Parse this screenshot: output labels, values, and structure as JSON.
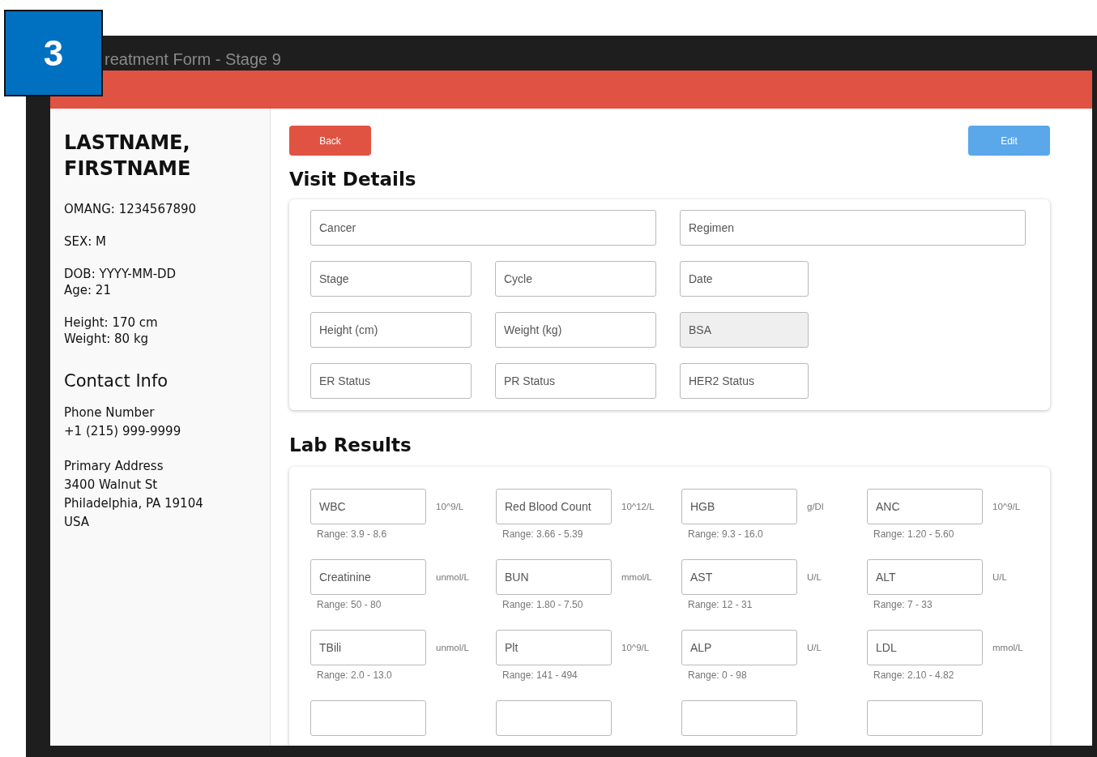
{
  "step_badge": "3",
  "window": {
    "title": "reatment Form - Stage 9"
  },
  "patient": {
    "name": "LASTNAME, FIRSTNAME",
    "details": [
      [
        "OMANG: 1234567890"
      ],
      [
        "SEX: M"
      ],
      [
        "DOB: YYYY-MM-DD",
        "Age: 21"
      ],
      [
        "Height: 170 cm",
        "Weight: 80 kg"
      ]
    ]
  },
  "contact": {
    "title": "Contact Info",
    "groups": [
      {
        "label": "Phone Number",
        "lines": [
          "+1 (215) 999-9999"
        ]
      },
      {
        "label": "Primary Address",
        "lines": [
          "3400 Walnut St",
          "Philadelphia, PA 19104",
          "USA"
        ]
      }
    ]
  },
  "buttons": {
    "back": "Back",
    "edit": "Edit"
  },
  "visit_details": {
    "title": "Visit Details",
    "rows": [
      [
        {
          "placeholder": "Cancer",
          "colspan": 2,
          "disabled": false
        },
        {
          "placeholder": "Regimen",
          "colspan": 2,
          "disabled": false
        }
      ],
      [
        {
          "placeholder": "Stage",
          "disabled": false
        },
        {
          "placeholder": "Cycle",
          "disabled": false
        },
        {
          "placeholder": "Date",
          "disabled": false
        }
      ],
      [
        {
          "placeholder": "Height (cm)",
          "disabled": false
        },
        {
          "placeholder": "Weight (kg)",
          "disabled": false
        },
        {
          "placeholder": "BSA",
          "disabled": true
        }
      ],
      [
        {
          "placeholder": "ER Status",
          "disabled": false
        },
        {
          "placeholder": "PR Status",
          "disabled": false
        },
        {
          "placeholder": "HER2 Status",
          "disabled": false
        }
      ]
    ]
  },
  "lab_results": {
    "title": "Lab Results",
    "items": [
      {
        "placeholder": "WBC",
        "unit": "10^9/L",
        "range": "Range: 3.9 - 8.6",
        "cut_off": false
      },
      {
        "placeholder": "Red Blood Count",
        "unit": "10^12/L",
        "range": "Range: 3.66 - 5.39",
        "cut_off": false
      },
      {
        "placeholder": "HGB",
        "unit": "g/Dl",
        "range": "Range: 9.3 - 16.0",
        "cut_off": false
      },
      {
        "placeholder": "ANC",
        "unit": "10^9/L",
        "range": "Range: 1.20 - 5.60",
        "cut_off": false
      },
      {
        "placeholder": "Creatinine",
        "unit": "unmol/L",
        "range": "Range: 50 - 80",
        "cut_off": false
      },
      {
        "placeholder": "BUN",
        "unit": "mmol/L",
        "range": "Range: 1.80 - 7.50",
        "cut_off": false
      },
      {
        "placeholder": "AST",
        "unit": "U/L",
        "range": "Range: 12 - 31",
        "cut_off": false
      },
      {
        "placeholder": "ALT",
        "unit": "U/L",
        "range": "Range: 7 - 33",
        "cut_off": false
      },
      {
        "placeholder": "TBili",
        "unit": "unmol/L",
        "range": "Range: 2.0 - 13.0",
        "cut_off": false
      },
      {
        "placeholder": "Plt",
        "unit": "10^9/L",
        "range": "Range: 141 - 494",
        "cut_off": false
      },
      {
        "placeholder": "ALP",
        "unit": "U/L",
        "range": "Range: 0 - 98",
        "cut_off": false
      },
      {
        "placeholder": "LDL",
        "unit": "mmol/L",
        "range": "Range: 2.10 - 4.82",
        "cut_off": false
      },
      {
        "cut_off": true
      },
      {
        "cut_off": true
      },
      {
        "cut_off": true
      },
      {
        "cut_off": true
      }
    ]
  }
}
